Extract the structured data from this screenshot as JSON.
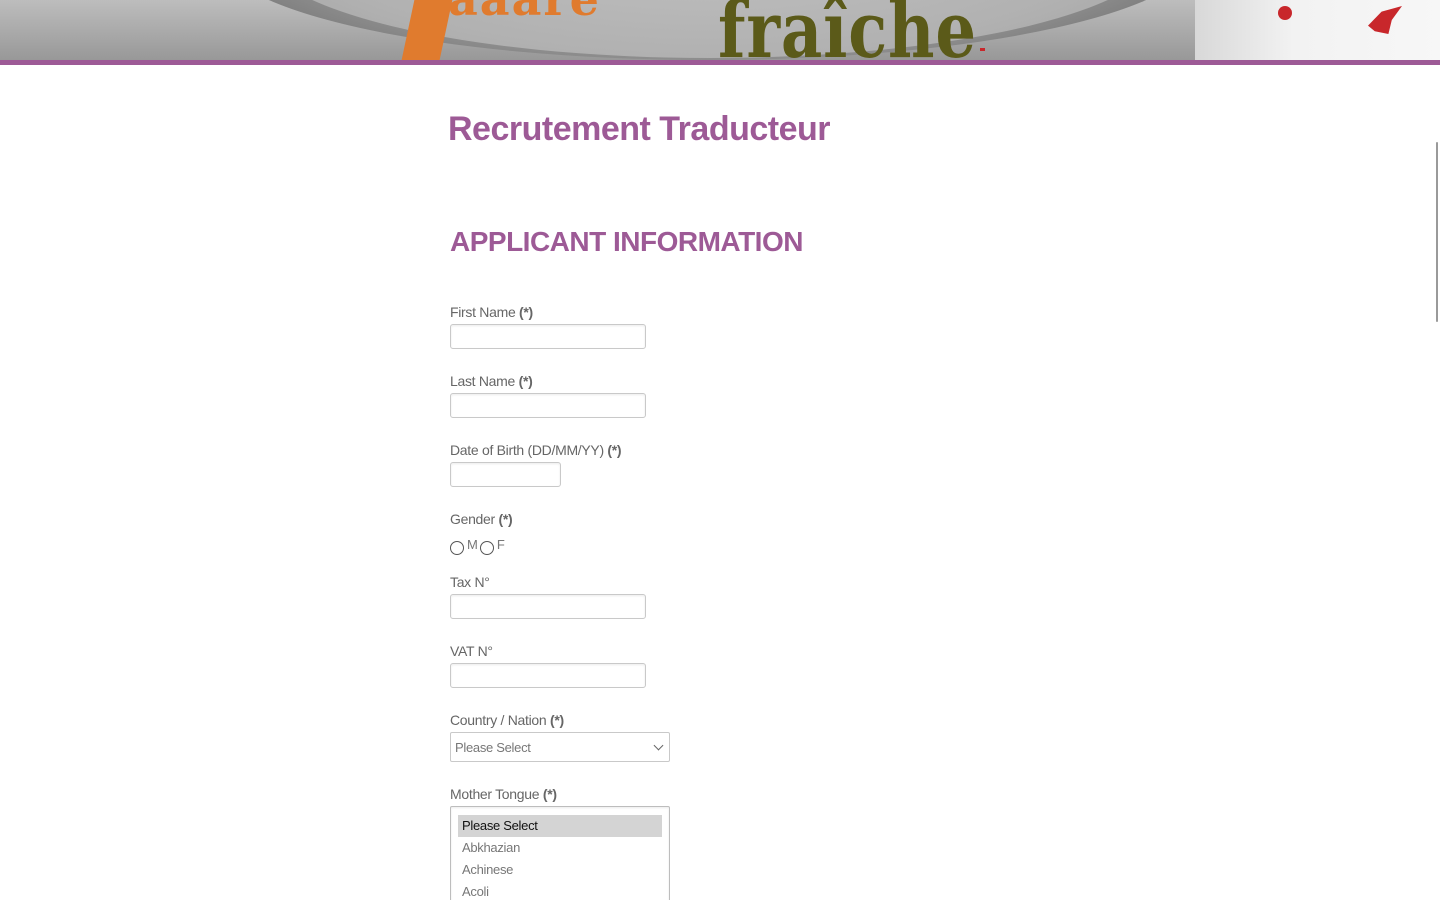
{
  "header": {
    "banner_text_orange": "aaare",
    "banner_text_green": "fraîche"
  },
  "form": {
    "title": "Recrutement Traducteur",
    "section_title": "APPLICANT INFORMATION",
    "required_marker": "(*)",
    "fields": {
      "first_name": {
        "label": "First Name",
        "value": ""
      },
      "last_name": {
        "label": "Last Name",
        "value": ""
      },
      "dob": {
        "label": "Date of Birth (DD/MM/YY)",
        "value": ""
      },
      "gender": {
        "label": "Gender",
        "options": [
          "M",
          "F"
        ],
        "selected": null
      },
      "tax": {
        "label": "Tax N°",
        "value": ""
      },
      "vat": {
        "label": "VAT N°",
        "value": ""
      },
      "country": {
        "label": "Country / Nation",
        "selected": "Please Select"
      },
      "mother_tongue": {
        "label": "Mother Tongue",
        "options": [
          "Please Select",
          "Abkhazian",
          "Achinese",
          "Acoli"
        ],
        "selected": "Please Select"
      }
    }
  },
  "colors": {
    "accent": "#9d5a96",
    "label": "#666666",
    "input_border": "#c9c9c9"
  }
}
